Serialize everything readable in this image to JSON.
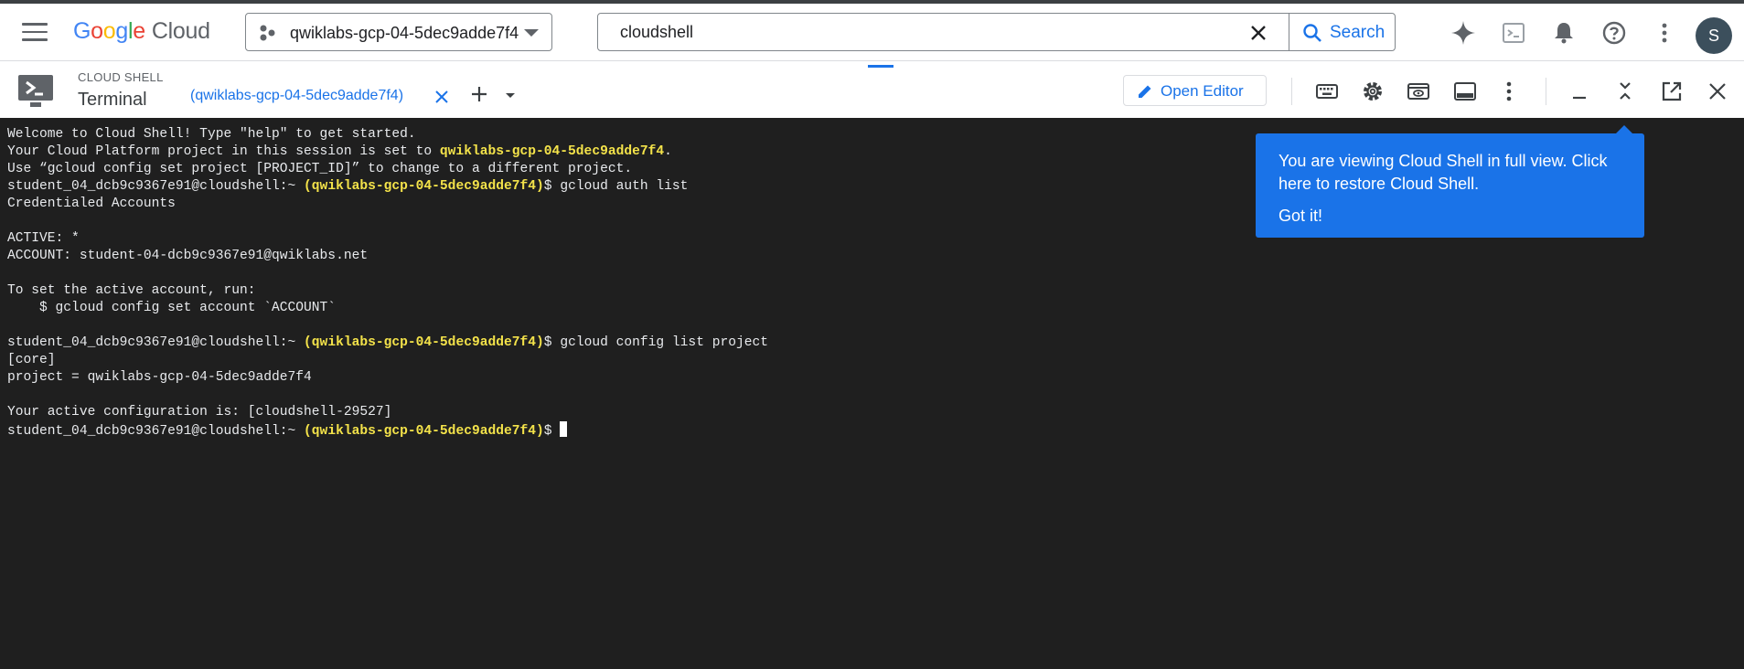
{
  "header": {
    "logo_text": "Google Cloud",
    "project_selector": "qwiklabs-gcp-04-5dec9adde7f4",
    "search": {
      "value": "cloudshell",
      "button_label": "Search"
    },
    "avatar_initial": "S",
    "icons": [
      "menu-icon",
      "gemini-sparkle-icon",
      "cloud-shell-icon",
      "notifications-bell-icon",
      "help-icon",
      "more-vert-icon"
    ]
  },
  "shellbar": {
    "label": "CLOUD SHELL",
    "title": "Terminal",
    "tab_label": "(qwiklabs-gcp-04-5dec9adde7f4)",
    "open_editor_label": "Open Editor",
    "icons": [
      "keyboard-icon",
      "settings-gear-icon",
      "web-preview-icon",
      "layout-icon",
      "more-vert-icon",
      "minimize-icon",
      "collapse-icon",
      "open-in-new-window-icon",
      "close-icon"
    ]
  },
  "terminal": {
    "welcome": "Welcome to Cloud Shell! Type \"help\" to get started.",
    "project_line_prefix": "Your Cloud Platform project in this session is set to ",
    "project_id": "qwiklabs-gcp-04-5dec9adde7f4",
    "project_line_suffix": ".",
    "use_line": "Use “gcloud config set project [PROJECT_ID]” to change to a different project.",
    "prompt_user": "student_04_dcb9c9367e91@cloudshell:~",
    "prompt_project": "(qwiklabs-gcp-04-5dec9adde7f4)",
    "prompt_symbol": "$",
    "cmd1": "gcloud auth list",
    "credentialed": "Credentialed Accounts",
    "active": "ACTIVE: *",
    "account": "ACCOUNT: student-04-dcb9c9367e91@qwiklabs.net",
    "to_set": "To set the active account, run:",
    "set_cmd": "    $ gcloud config set account `ACCOUNT`",
    "cmd2": "gcloud config list project",
    "core": "[core]",
    "project_value": "project = qwiklabs-gcp-04-5dec9adde7f4",
    "active_config": "Your active configuration is: [cloudshell-29527]"
  },
  "tooltip": {
    "text": "You are viewing Cloud Shell in full view. Click here to restore Cloud Shell.",
    "button": "Got it!"
  },
  "colors": {
    "terminal_bg": "#1f1f1f",
    "project_highlight": "#f4e34a",
    "accent_blue": "#1a73e8"
  }
}
